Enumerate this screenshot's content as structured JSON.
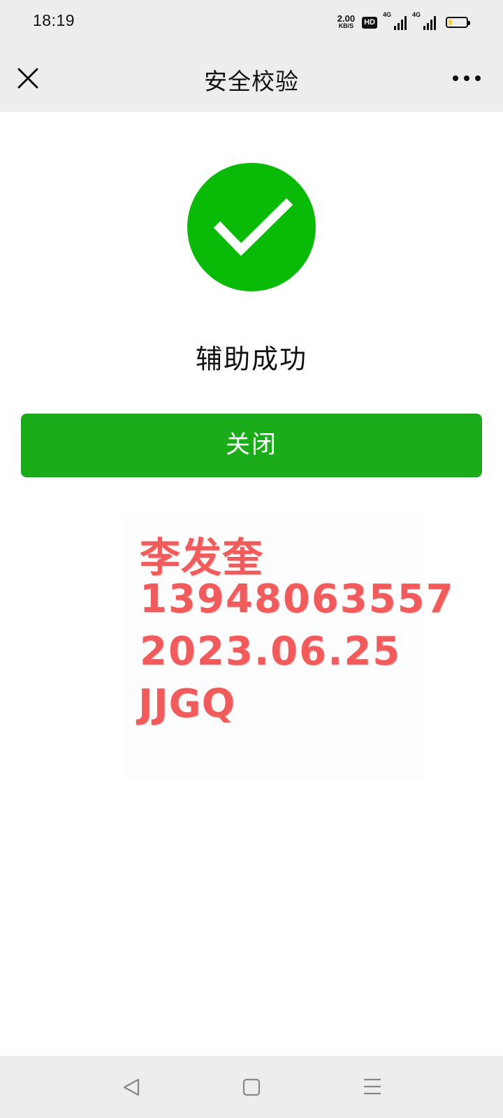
{
  "status_bar": {
    "time": "18:19",
    "net_speed_value": "2.00",
    "net_speed_unit": "KB/S",
    "hd_badge": "HD",
    "signal1_label": "4G",
    "signal2_label": "4G",
    "battery_level": 0.2,
    "battery_fill_color": "#f5d15a"
  },
  "nav": {
    "title": "安全校验",
    "close_icon": "close-icon",
    "more_icon": "more-icon"
  },
  "result": {
    "icon": "success-check-icon",
    "icon_color": "#09bb07",
    "message": "辅助成功"
  },
  "actions": {
    "close_label": "关闭",
    "button_color": "#1aad19"
  },
  "watermark": {
    "name": "李发奎",
    "phone": "13948063557",
    "date": "2023.06.25",
    "code": "JJGQ",
    "color": "#f25b5b"
  },
  "system_nav": {
    "back_icon": "back-triangle-icon",
    "home_icon": "home-square-icon",
    "menu_icon": "menu-lines-icon"
  }
}
